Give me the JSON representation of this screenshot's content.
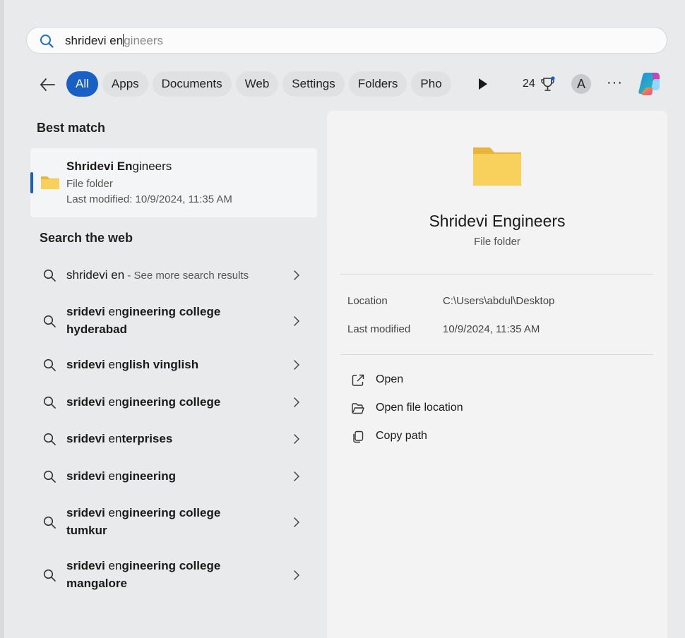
{
  "search": {
    "typed": "shridevi en",
    "suggestion": "gineers"
  },
  "filters": {
    "chips": [
      "All",
      "Apps",
      "Documents",
      "Web",
      "Settings",
      "Folders",
      "Pho"
    ],
    "active": "All",
    "points": "24",
    "avatar_letter": "A",
    "more": "···"
  },
  "best_match": {
    "heading": "Best match",
    "name_bold": "Shridevi En",
    "name_rest": "gineers",
    "type": "File folder",
    "modified": "Last modified: 10/9/2024, 11:35 AM"
  },
  "web": {
    "heading": "Search the web",
    "first": {
      "query": "shridevi en",
      "sub": " - See more search results"
    },
    "items": [
      {
        "pre": "sridevi ",
        "mid": "en",
        "post": "gineering college",
        "line2": "hyderabad"
      },
      {
        "pre": "sridevi ",
        "mid": "en",
        "post": "glish vinglish",
        "line2": ""
      },
      {
        "pre": "sridevi ",
        "mid": "en",
        "post": "gineering college",
        "line2": ""
      },
      {
        "pre": "sridevi ",
        "mid": "en",
        "post": "terprises",
        "line2": ""
      },
      {
        "pre": "sridevi ",
        "mid": "en",
        "post": "gineering",
        "line2": ""
      },
      {
        "pre": "sridevi ",
        "mid": "en",
        "post": "gineering college",
        "line2": "tumkur"
      },
      {
        "pre": "sridevi ",
        "mid": "en",
        "post": "gineering college",
        "line2": "mangalore"
      }
    ]
  },
  "preview": {
    "title": "Shridevi Engineers",
    "subtitle": "File folder",
    "location_label": "Location",
    "location_value": "C:\\Users\\abdul\\Desktop",
    "modified_label": "Last modified",
    "modified_value": "10/9/2024, 11:35 AM",
    "actions": [
      "Open",
      "Open file location",
      "Copy path"
    ]
  },
  "colors": {
    "accent": "#1860c6",
    "folder": "#f7cc4e"
  }
}
